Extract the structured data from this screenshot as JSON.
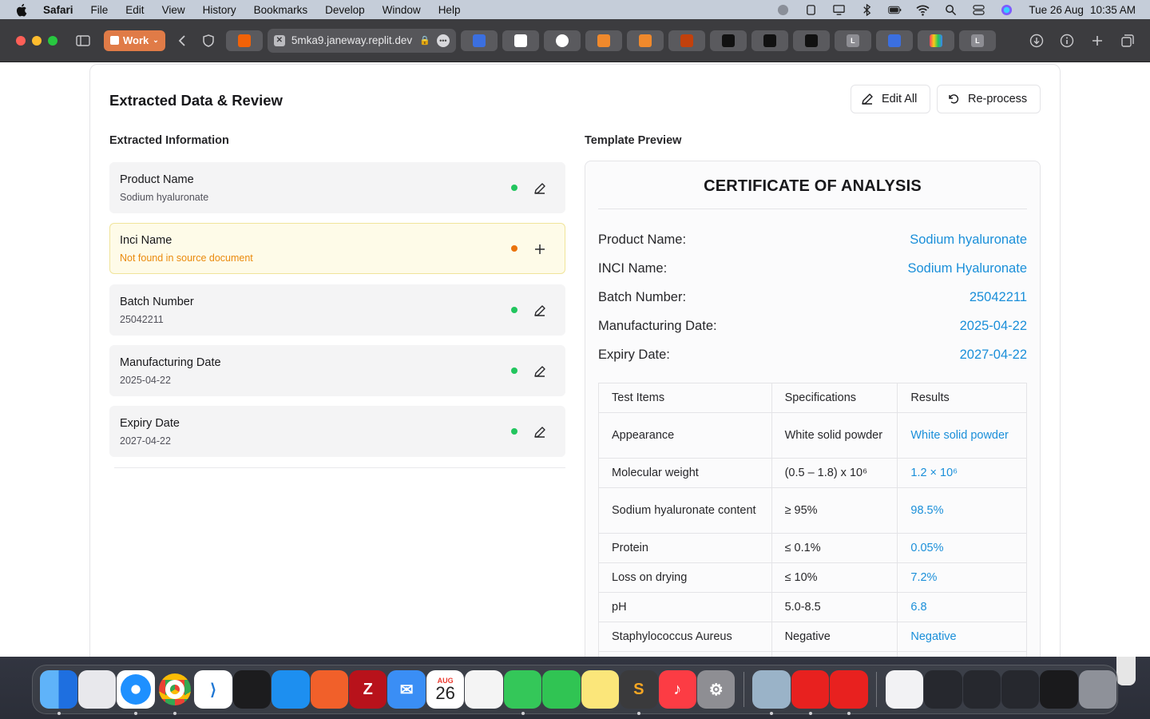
{
  "menubar": {
    "app_name": "Safari",
    "items": [
      "File",
      "Edit",
      "View",
      "History",
      "Bookmarks",
      "Develop",
      "Window",
      "Help"
    ],
    "date": "Tue 26 Aug",
    "time": "10:35 AM"
  },
  "browser": {
    "profile": "Work",
    "url": "5mka9.janeway.replit.dev",
    "pinned_tab_initial": "L"
  },
  "page": {
    "title": "Extracted Data & Review",
    "edit_all_label": "Edit All",
    "reprocess_label": "Re-process",
    "extracted_heading": "Extracted Information",
    "preview_heading": "Template Preview",
    "fields": [
      {
        "label": "Product Name",
        "value": "Sodium hyaluronate",
        "status": "found"
      },
      {
        "label": "Inci Name",
        "value": "Not found in source document",
        "status": "missing"
      },
      {
        "label": "Batch Number",
        "value": "25042211",
        "status": "found"
      },
      {
        "label": "Manufacturing Date",
        "value": "2025-04-22",
        "status": "found"
      },
      {
        "label": "Expiry Date",
        "value": "2027-04-22",
        "status": "found"
      }
    ],
    "status_colors": {
      "found": "#22c55e",
      "missing": "#ea730c"
    }
  },
  "certificate": {
    "title": "CERTIFICATE OF ANALYSIS",
    "info": [
      {
        "key": "Product Name:",
        "value": "Sodium hyaluronate"
      },
      {
        "key": "INCI Name:",
        "value": "Sodium Hyaluronate"
      },
      {
        "key": "Batch Number:",
        "value": "25042211"
      },
      {
        "key": "Manufacturing Date:",
        "value": "2025-04-22"
      },
      {
        "key": "Expiry Date:",
        "value": "2027-04-22"
      }
    ],
    "table_headers": [
      "Test Items",
      "Specifications",
      "Results"
    ],
    "rows": [
      {
        "item": "Appearance",
        "spec": "White solid powder",
        "result": "White solid powder"
      },
      {
        "item": "Molecular weight",
        "spec": "(0.5 – 1.8) x 10⁶",
        "result": "1.2 × 10⁶"
      },
      {
        "item": "Sodium hyaluronate content",
        "spec": "≥ 95%",
        "result": "98.5%"
      },
      {
        "item": "Protein",
        "spec": "≤ 0.1%",
        "result": "0.05%"
      },
      {
        "item": "Loss on drying",
        "spec": "≤ 10%",
        "result": "7.2%"
      },
      {
        "item": "pH",
        "spec": "5.0-8.5",
        "result": "6.8"
      },
      {
        "item": "Staphylococcus Aureus",
        "spec": "Negative",
        "result": "Negative"
      }
    ]
  },
  "dock": {
    "calendar_month": "AUG",
    "calendar_day": "26"
  }
}
